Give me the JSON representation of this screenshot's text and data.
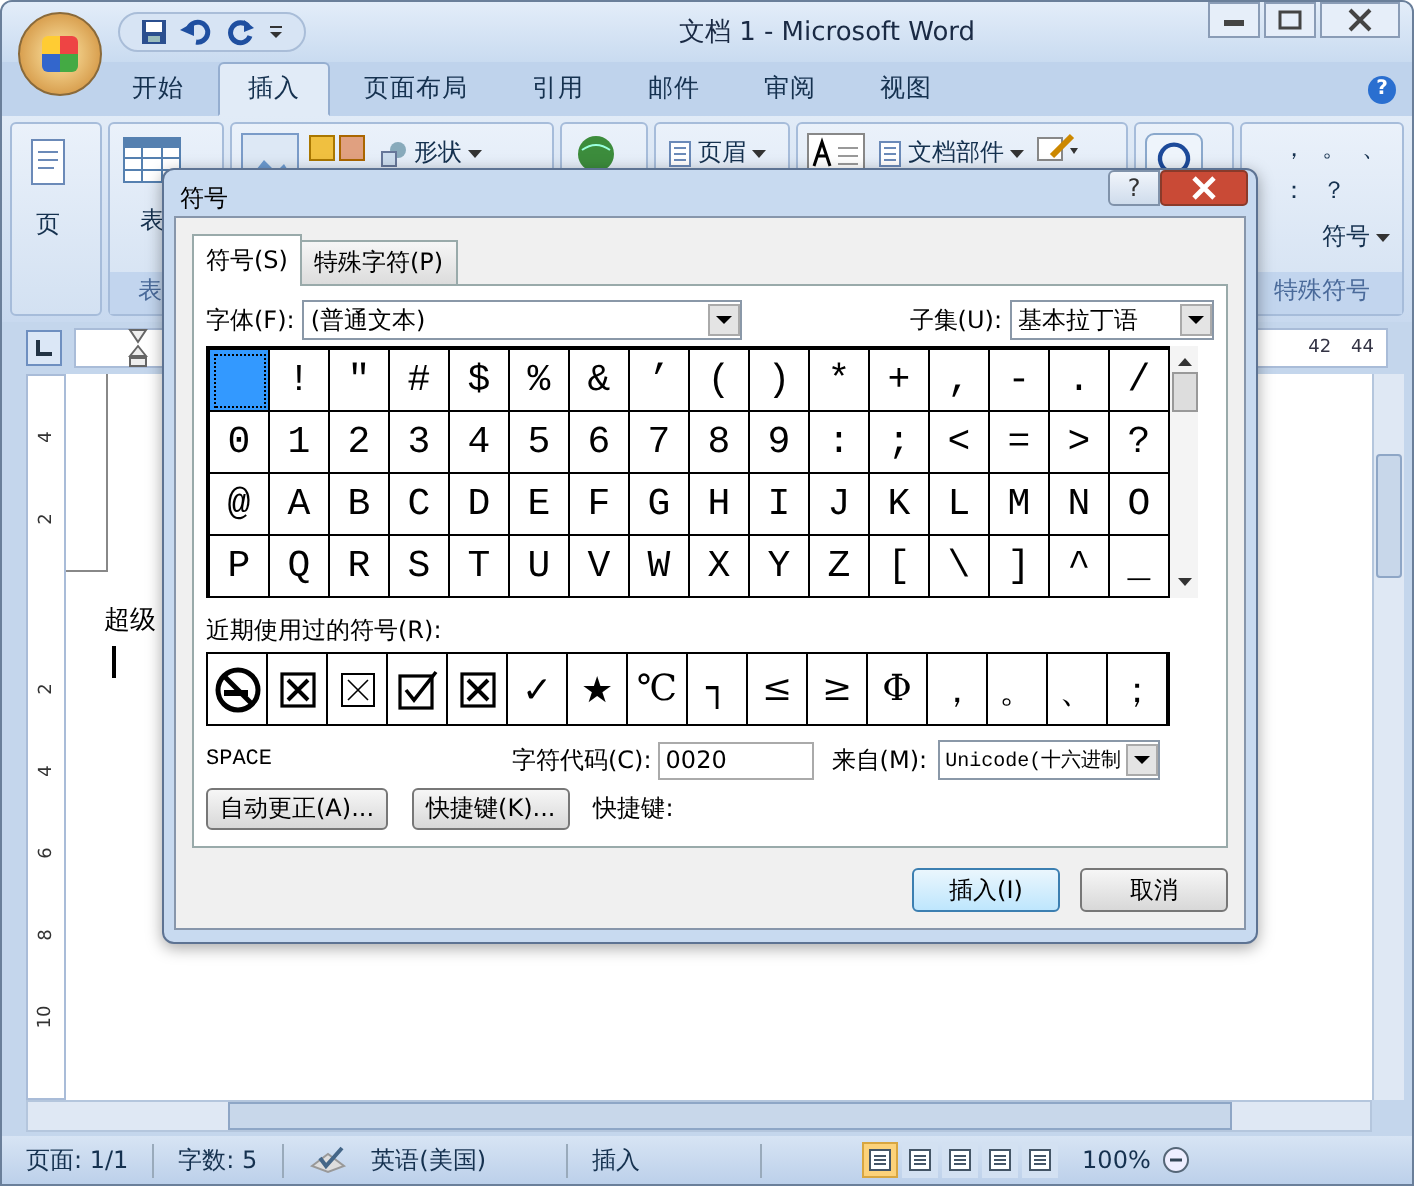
{
  "window": {
    "title": "文档 1 - Microsoft Word"
  },
  "ribbon_tabs": [
    {
      "label": "开始",
      "selected": false
    },
    {
      "label": "插入",
      "selected": true
    },
    {
      "label": "页面布局",
      "selected": false
    },
    {
      "label": "引用",
      "selected": false
    },
    {
      "label": "邮件",
      "selected": false
    },
    {
      "label": "审阅",
      "selected": false
    },
    {
      "label": "视图",
      "selected": false
    }
  ],
  "help_glyph": "?",
  "ribbon_groups": [
    {
      "items": [
        {
          "kind": "page",
          "label": "页"
        }
      ]
    },
    {
      "label": "表",
      "items": [
        {
          "kind": "table",
          "label": "表"
        }
      ]
    },
    {
      "items": [
        {
          "kind": "picture"
        },
        {
          "kind": "clipart"
        },
        {
          "kind": "shapes",
          "label": "形状"
        }
      ]
    },
    {
      "items": [
        {
          "kind": "link"
        }
      ]
    },
    {
      "items": [
        {
          "kind": "header",
          "label": "页眉"
        }
      ]
    },
    {
      "items": [
        {
          "kind": "textbox"
        },
        {
          "kind": "parts",
          "label": "文档部件"
        },
        {
          "kind": "signature"
        }
      ]
    },
    {
      "items": [
        {
          "kind": "omega"
        }
      ]
    },
    {
      "label": "特殊符号",
      "items": [
        {
          "kind": "symbols",
          "symbols": [
            "，",
            "。",
            "、",
            "：",
            "？"
          ]
        },
        {
          "kind": "symbol-dropdown",
          "label": "符号"
        }
      ]
    }
  ],
  "ruler": {
    "numbers": [
      "42",
      "44"
    ]
  },
  "vertical_ruler": {
    "numbers": [
      "4",
      "2",
      "2",
      "4",
      "6",
      "8",
      "10"
    ]
  },
  "document": {
    "text": "超级"
  },
  "dialog": {
    "title": "符号",
    "help_label": "?",
    "tabs": [
      {
        "label": "符号(S)",
        "selected": true
      },
      {
        "label": "特殊字符(P)",
        "selected": false
      }
    ],
    "font": {
      "label": "字体(F):",
      "value": "(普通文本)"
    },
    "subset": {
      "label": "子集(U):",
      "value": "基本拉丁语"
    },
    "symbols": [
      {
        "selected": true
      },
      {
        "char": "!",
        "selected": false
      },
      {
        "char": "″",
        "selected": false
      },
      {
        "char": "#",
        "selected": false
      },
      {
        "char": "$",
        "selected": false
      },
      {
        "char": "%",
        "selected": false
      },
      {
        "char": "&",
        "selected": false
      },
      {
        "char": "’",
        "selected": false
      },
      {
        "char": "(",
        "selected": false
      },
      {
        "char": ")",
        "selected": false
      },
      {
        "char": "*",
        "selected": false
      },
      {
        "char": "+",
        "selected": false
      },
      {
        "char": ",",
        "selected": false
      },
      {
        "char": "-",
        "selected": false
      },
      {
        "char": ".",
        "selected": false
      },
      {
        "char": "/",
        "selected": false
      },
      {
        "char": "0",
        "selected": false
      },
      {
        "char": "1",
        "selected": false
      },
      {
        "char": "2",
        "selected": false
      },
      {
        "char": "3",
        "selected": false
      },
      {
        "char": "4",
        "selected": false
      },
      {
        "char": "5",
        "selected": false
      },
      {
        "char": "6",
        "selected": false
      },
      {
        "char": "7",
        "selected": false
      },
      {
        "char": "8",
        "selected": false
      },
      {
        "char": "9",
        "selected": false
      },
      {
        "char": ":",
        "selected": false
      },
      {
        "char": ";",
        "selected": false
      },
      {
        "char": "<",
        "selected": false
      },
      {
        "char": "=",
        "selected": false
      },
      {
        "char": ">",
        "selected": false
      },
      {
        "char": "?",
        "selected": false
      },
      {
        "char": "@",
        "selected": false
      },
      {
        "char": "A",
        "selected": false
      },
      {
        "char": "B",
        "selected": false
      },
      {
        "char": "C",
        "selected": false
      },
      {
        "char": "D",
        "selected": false
      },
      {
        "char": "E",
        "selected": false
      },
      {
        "char": "F",
        "selected": false
      },
      {
        "char": "G",
        "selected": false
      },
      {
        "char": "H",
        "selected": false
      },
      {
        "char": "I",
        "selected": false
      },
      {
        "char": "J",
        "selected": false
      },
      {
        "char": "K",
        "selected": false
      },
      {
        "char": "L",
        "selected": false
      },
      {
        "char": "M",
        "selected": false
      },
      {
        "char": "N",
        "selected": false
      },
      {
        "char": "O",
        "selected": false
      },
      {
        "char": "P",
        "selected": false
      },
      {
        "char": "Q",
        "selected": false
      },
      {
        "char": "R",
        "selected": false
      },
      {
        "char": "S",
        "selected": false
      },
      {
        "char": "T",
        "selected": false
      },
      {
        "char": "U",
        "selected": false
      },
      {
        "char": "V",
        "selected": false
      },
      {
        "char": "W",
        "selected": false
      },
      {
        "char": "X",
        "selected": false
      },
      {
        "char": "Y",
        "selected": false
      },
      {
        "char": "Z",
        "selected": false
      },
      {
        "char": "[",
        "selected": false
      },
      {
        "char": "\\",
        "selected": false
      },
      {
        "char": "]",
        "selected": false
      },
      {
        "char": "^",
        "selected": false
      },
      {
        "char": "_",
        "selected": false
      }
    ],
    "recent_label": "近期使用过的符号(R):",
    "recent": [
      {
        "kind": "no-smoking"
      },
      {
        "kind": "boxed-x-bold"
      },
      {
        "kind": "boxed-x-thin"
      },
      {
        "kind": "checked-box"
      },
      {
        "kind": "boxed-x-bold"
      },
      {
        "kind": "char",
        "char": "✓"
      },
      {
        "kind": "char",
        "char": "★"
      },
      {
        "kind": "char",
        "char": "℃"
      },
      {
        "kind": "char",
        "char": "┐"
      },
      {
        "kind": "char",
        "char": "≤"
      },
      {
        "kind": "char",
        "char": "≥"
      },
      {
        "kind": "char",
        "char": "Φ"
      },
      {
        "kind": "char",
        "char": "，"
      },
      {
        "kind": "char",
        "char": "。"
      },
      {
        "kind": "char",
        "char": "、"
      },
      {
        "kind": "char",
        "char": "；"
      }
    ],
    "char_name": "SPACE",
    "code": {
      "label": "字符代码(C):",
      "value": "0020"
    },
    "from": {
      "label": "来自(M):",
      "value": "Unicode(十六进制"
    },
    "buttons": [
      "自动更正(A)...",
      "快捷键(K)..."
    ],
    "shortcut_label": "快捷键:",
    "footer_buttons": [
      {
        "label": "插入(I)",
        "default": true
      },
      {
        "label": "取消",
        "default": false
      }
    ]
  },
  "status_bar": {
    "items": [
      "页面: 1/1",
      "字数: 5"
    ],
    "language": "英语(美国)",
    "mode": "插入",
    "zoom": "100%"
  },
  "view_buttons": [
    {
      "selected": true
    },
    {
      "selected": false
    },
    {
      "selected": false
    },
    {
      "selected": false
    },
    {
      "selected": false
    }
  ]
}
